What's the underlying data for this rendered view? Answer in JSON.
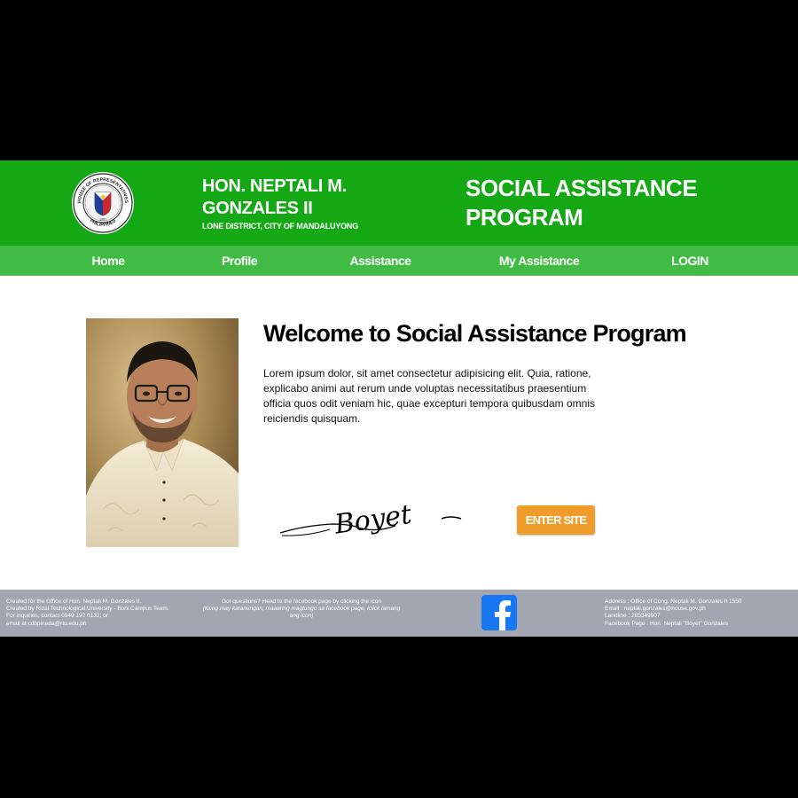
{
  "header": {
    "seal": {
      "text_top": "HOUSE OF REPRESENTATIVES",
      "text_bottom": "PHILIPPINES",
      "year": "1907"
    },
    "rep_name": "HON. NEPTALI M. GONZALES II",
    "district": "LONE DISTRICT, CITY OF MANDALUYONG",
    "program_title": "SOCIAL ASSISTANCE PROGRAM"
  },
  "nav": {
    "items": [
      {
        "label": "Home"
      },
      {
        "label": "Profile"
      },
      {
        "label": "Assistance"
      },
      {
        "label": "My Assistance"
      },
      {
        "label": "LOGIN"
      }
    ]
  },
  "main": {
    "welcome_title": "Welcome to Social Assistance Program",
    "intro_text": "Lorem ipsum dolor, sit amet consectetur adipisicing elit. Quia, ratione, explicabo animi aut rerum unde voluptas necessitatibus praesentium officia quos odit veniam hic, quae excepturi tempora quibusdam omnis reiciendis quisquam.",
    "signature_text": "Boyet",
    "enter_button": "ENTER SITE"
  },
  "footer": {
    "left_lines": [
      "Created for the Office of Hon. Neptali M. Gonzales II.",
      "Created by Rizal Technological University - Boni Campus Team.",
      "For inquiries, contact 0949 192 6132, or",
      "email at cdbpineda@rtu.edu.ph"
    ],
    "mid_line": "Got questions? Head to the facebook page by clicking the icon",
    "mid_tagalog": "(Kung may katanungan, maaaring magtungo sa facebook page, iclick lamang ang icon)",
    "right_lines": [
      "Address : Office of Cong. Neptali M. Gonzales II 1550",
      "Email : neptali.gonzales@house.gov.ph",
      "Landline : 285349907",
      "Facebook Page : Hon. Neptali \"Boyet\" Gonzales"
    ],
    "facebook_icon": "facebook-icon"
  },
  "colors": {
    "header_green": "#13a814",
    "nav_green": "#40bc44",
    "button_orange": "#f09c2b",
    "footer_gray": "#a1a6b0",
    "facebook_blue": "#1877f2"
  }
}
